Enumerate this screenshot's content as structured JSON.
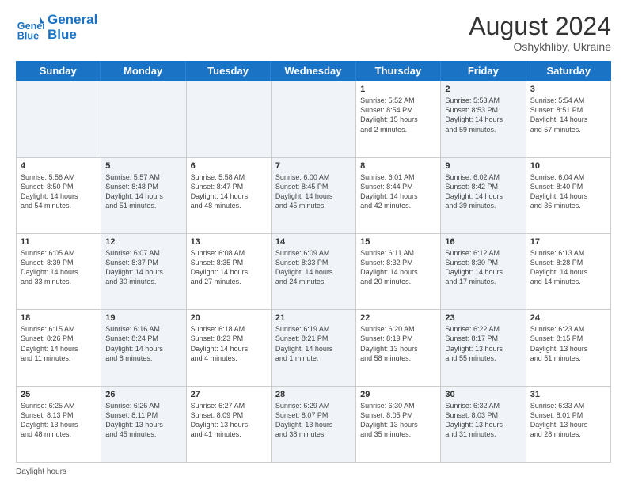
{
  "header": {
    "logo_line1": "General",
    "logo_line2": "Blue",
    "month_year": "August 2024",
    "location": "Oshykhliby, Ukraine"
  },
  "footer": {
    "daylight_label": "Daylight hours"
  },
  "days_of_week": [
    "Sunday",
    "Monday",
    "Tuesday",
    "Wednesday",
    "Thursday",
    "Friday",
    "Saturday"
  ],
  "weeks": [
    [
      {
        "num": "",
        "info": "",
        "shaded": true
      },
      {
        "num": "",
        "info": "",
        "shaded": true
      },
      {
        "num": "",
        "info": "",
        "shaded": true
      },
      {
        "num": "",
        "info": "",
        "shaded": true
      },
      {
        "num": "1",
        "info": "Sunrise: 5:52 AM\nSunset: 8:54 PM\nDaylight: 15 hours\nand 2 minutes.",
        "shaded": false
      },
      {
        "num": "2",
        "info": "Sunrise: 5:53 AM\nSunset: 8:53 PM\nDaylight: 14 hours\nand 59 minutes.",
        "shaded": true
      },
      {
        "num": "3",
        "info": "Sunrise: 5:54 AM\nSunset: 8:51 PM\nDaylight: 14 hours\nand 57 minutes.",
        "shaded": false
      }
    ],
    [
      {
        "num": "4",
        "info": "Sunrise: 5:56 AM\nSunset: 8:50 PM\nDaylight: 14 hours\nand 54 minutes.",
        "shaded": false
      },
      {
        "num": "5",
        "info": "Sunrise: 5:57 AM\nSunset: 8:48 PM\nDaylight: 14 hours\nand 51 minutes.",
        "shaded": true
      },
      {
        "num": "6",
        "info": "Sunrise: 5:58 AM\nSunset: 8:47 PM\nDaylight: 14 hours\nand 48 minutes.",
        "shaded": false
      },
      {
        "num": "7",
        "info": "Sunrise: 6:00 AM\nSunset: 8:45 PM\nDaylight: 14 hours\nand 45 minutes.",
        "shaded": true
      },
      {
        "num": "8",
        "info": "Sunrise: 6:01 AM\nSunset: 8:44 PM\nDaylight: 14 hours\nand 42 minutes.",
        "shaded": false
      },
      {
        "num": "9",
        "info": "Sunrise: 6:02 AM\nSunset: 8:42 PM\nDaylight: 14 hours\nand 39 minutes.",
        "shaded": true
      },
      {
        "num": "10",
        "info": "Sunrise: 6:04 AM\nSunset: 8:40 PM\nDaylight: 14 hours\nand 36 minutes.",
        "shaded": false
      }
    ],
    [
      {
        "num": "11",
        "info": "Sunrise: 6:05 AM\nSunset: 8:39 PM\nDaylight: 14 hours\nand 33 minutes.",
        "shaded": false
      },
      {
        "num": "12",
        "info": "Sunrise: 6:07 AM\nSunset: 8:37 PM\nDaylight: 14 hours\nand 30 minutes.",
        "shaded": true
      },
      {
        "num": "13",
        "info": "Sunrise: 6:08 AM\nSunset: 8:35 PM\nDaylight: 14 hours\nand 27 minutes.",
        "shaded": false
      },
      {
        "num": "14",
        "info": "Sunrise: 6:09 AM\nSunset: 8:33 PM\nDaylight: 14 hours\nand 24 minutes.",
        "shaded": true
      },
      {
        "num": "15",
        "info": "Sunrise: 6:11 AM\nSunset: 8:32 PM\nDaylight: 14 hours\nand 20 minutes.",
        "shaded": false
      },
      {
        "num": "16",
        "info": "Sunrise: 6:12 AM\nSunset: 8:30 PM\nDaylight: 14 hours\nand 17 minutes.",
        "shaded": true
      },
      {
        "num": "17",
        "info": "Sunrise: 6:13 AM\nSunset: 8:28 PM\nDaylight: 14 hours\nand 14 minutes.",
        "shaded": false
      }
    ],
    [
      {
        "num": "18",
        "info": "Sunrise: 6:15 AM\nSunset: 8:26 PM\nDaylight: 14 hours\nand 11 minutes.",
        "shaded": false
      },
      {
        "num": "19",
        "info": "Sunrise: 6:16 AM\nSunset: 8:24 PM\nDaylight: 14 hours\nand 8 minutes.",
        "shaded": true
      },
      {
        "num": "20",
        "info": "Sunrise: 6:18 AM\nSunset: 8:23 PM\nDaylight: 14 hours\nand 4 minutes.",
        "shaded": false
      },
      {
        "num": "21",
        "info": "Sunrise: 6:19 AM\nSunset: 8:21 PM\nDaylight: 14 hours\nand 1 minute.",
        "shaded": true
      },
      {
        "num": "22",
        "info": "Sunrise: 6:20 AM\nSunset: 8:19 PM\nDaylight: 13 hours\nand 58 minutes.",
        "shaded": false
      },
      {
        "num": "23",
        "info": "Sunrise: 6:22 AM\nSunset: 8:17 PM\nDaylight: 13 hours\nand 55 minutes.",
        "shaded": true
      },
      {
        "num": "24",
        "info": "Sunrise: 6:23 AM\nSunset: 8:15 PM\nDaylight: 13 hours\nand 51 minutes.",
        "shaded": false
      }
    ],
    [
      {
        "num": "25",
        "info": "Sunrise: 6:25 AM\nSunset: 8:13 PM\nDaylight: 13 hours\nand 48 minutes.",
        "shaded": false
      },
      {
        "num": "26",
        "info": "Sunrise: 6:26 AM\nSunset: 8:11 PM\nDaylight: 13 hours\nand 45 minutes.",
        "shaded": true
      },
      {
        "num": "27",
        "info": "Sunrise: 6:27 AM\nSunset: 8:09 PM\nDaylight: 13 hours\nand 41 minutes.",
        "shaded": false
      },
      {
        "num": "28",
        "info": "Sunrise: 6:29 AM\nSunset: 8:07 PM\nDaylight: 13 hours\nand 38 minutes.",
        "shaded": true
      },
      {
        "num": "29",
        "info": "Sunrise: 6:30 AM\nSunset: 8:05 PM\nDaylight: 13 hours\nand 35 minutes.",
        "shaded": false
      },
      {
        "num": "30",
        "info": "Sunrise: 6:32 AM\nSunset: 8:03 PM\nDaylight: 13 hours\nand 31 minutes.",
        "shaded": true
      },
      {
        "num": "31",
        "info": "Sunrise: 6:33 AM\nSunset: 8:01 PM\nDaylight: 13 hours\nand 28 minutes.",
        "shaded": false
      }
    ]
  ]
}
